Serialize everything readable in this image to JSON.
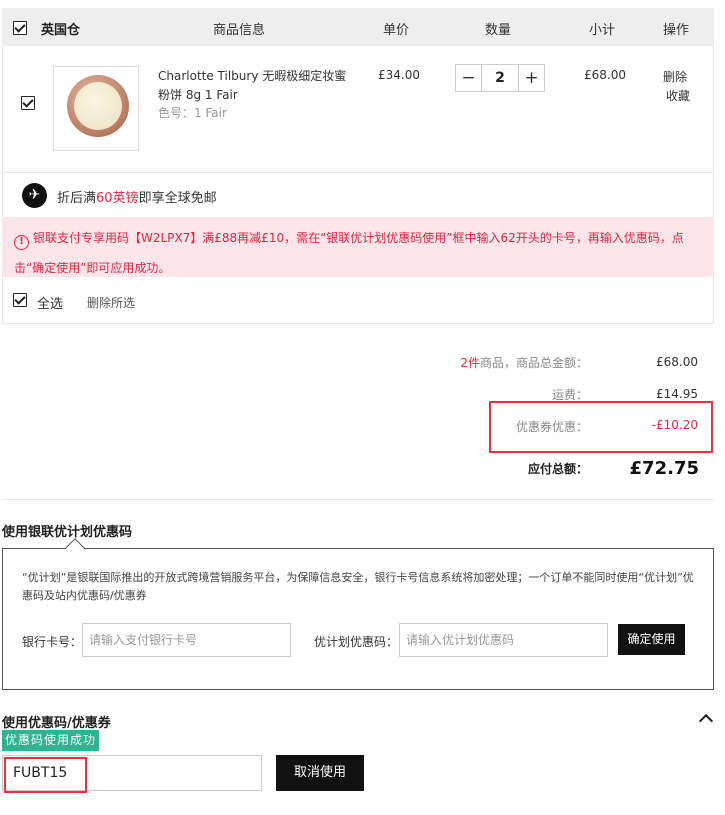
{
  "header": {
    "warehouse": "英国仓",
    "col_info": "商品信息",
    "col_price": "单价",
    "col_qty": "数量",
    "col_subtotal": "小计",
    "col_action": "操作"
  },
  "product": {
    "name_line1": "Charlotte Tilbury 无暇极细定妆蜜",
    "name_line2": "粉饼 8g 1 Fair",
    "shade": "色号：1 Fair",
    "price": "£34.00",
    "quantity": "2",
    "subtotal": "£68.00",
    "delete_label": "删除",
    "favorite_label": "收藏",
    "image_icon": "pressed-powder-compact"
  },
  "shipping_promo": {
    "prefix": "折后满",
    "amount": "60英镑",
    "suffix": "即享全球免邮",
    "icon": "airplane-icon"
  },
  "warning": {
    "icon": "!",
    "text": "银联支付专享用码【W2LPX7】满£88再减£10，需在“银联优计划优惠码使用”框中输入62开头的卡号，再输入优惠码，点击“确定使用”即可应用成功。"
  },
  "bulk": {
    "select_all": "全选",
    "delete_selected": "删除所选"
  },
  "summary": {
    "count": "2件",
    "goods_total_label": "商品，商品总金额：",
    "goods_total": "£68.00",
    "shipping_label": "运费：",
    "shipping": "£14.95",
    "coupon_label": "优惠券优惠：",
    "coupon": "-£10.20",
    "payable_label": "应付总额：",
    "payable": "£72.75"
  },
  "unionpay": {
    "title": "使用银联优计划优惠码",
    "description": "“优计划”是银联国际推出的开放式跨境营销服务平台，为保障信息安全，银行卡号信息系统将加密处理；一个订单不能同时使用“优计划”优惠码及站内优惠码/优惠券",
    "card_label": "银行卡号：",
    "card_placeholder": "请输入支付银行卡号",
    "code_label": "优计划优惠码：",
    "code_placeholder": "请输入优计划优惠码",
    "confirm_label": "确定使用"
  },
  "coupon": {
    "title": "使用优惠码/优惠券",
    "success_badge": "优惠码使用成功",
    "code_value": "FUBT15",
    "cancel_label": "取消使用"
  },
  "colors": {
    "accent_red": "#e0263f",
    "warning_bg": "#fde6ea",
    "success_green": "#2bb58f",
    "highlight_box": "#e8333a"
  }
}
